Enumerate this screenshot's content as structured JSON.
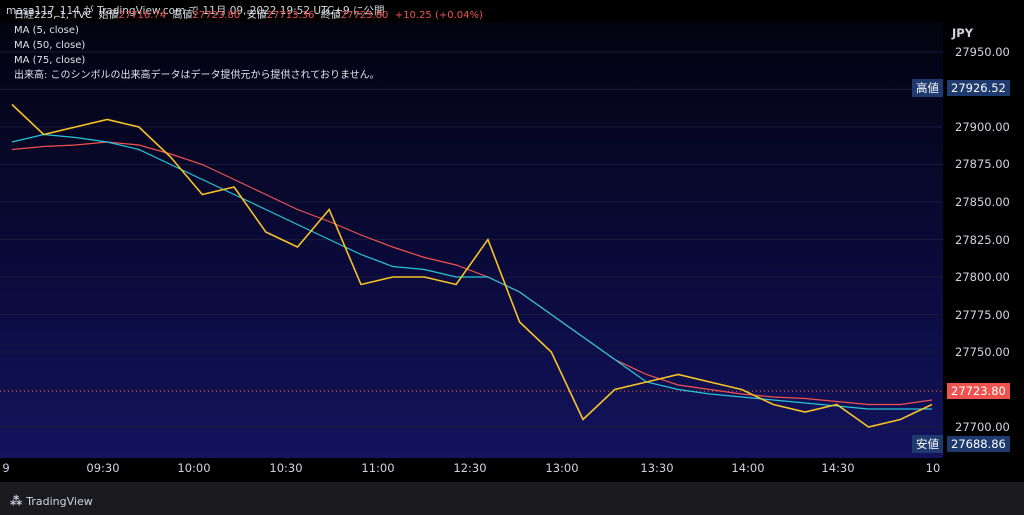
{
  "header": {
    "text": "masa117_114 が TradingView.com で 11月 09, 2022 19:52 UTC+9 に公開"
  },
  "legend": {
    "symbol": "日経225, 1, TVC",
    "open_label": "始値",
    "open": "27716.74",
    "high_label": "高値",
    "high": "27723.80",
    "low_label": "安値",
    "low": "27713.36",
    "close_label": "終値",
    "close": "27723.80",
    "change": "+10.25 (+0.04%)",
    "ma5": "MA (5, close)",
    "ma50": "MA (50, close)",
    "ma75": "MA (75, close)",
    "volume_note": "出来高: このシンボルの出来高データはデータ提供元から提供されておりません。"
  },
  "price_axis": {
    "currency": "JPY",
    "ticks": [
      "27950.00",
      "27925.00",
      "27900.00",
      "27875.00",
      "27850.00",
      "27825.00",
      "27800.00",
      "27775.00",
      "27750.00",
      "27725.00",
      "27700.00"
    ],
    "high_label": "高値",
    "high_value": "27926.52",
    "low_label": "安値",
    "low_value": "27688.86",
    "last_value": "27723.80"
  },
  "time_axis": {
    "labels": [
      "9",
      "09:30",
      "10:00",
      "10:30",
      "11:00",
      "12:30",
      "13:00",
      "13:30",
      "14:00",
      "14:30",
      "10"
    ]
  },
  "footer": {
    "brand": "TradingView"
  },
  "colors": {
    "up": "#26a69a",
    "down": "#1e88e5",
    "ma5": "#f7c325",
    "ma50": "#26c6da",
    "ma75": "#ef5350"
  },
  "chart_data": {
    "type": "line",
    "title": "日経225, 1, TVC",
    "ylim": [
      27688.86,
      27951
    ],
    "x": [
      "09:00",
      "09:10",
      "09:20",
      "09:30",
      "09:40",
      "09:50",
      "10:00",
      "10:10",
      "10:20",
      "10:30",
      "10:40",
      "10:50",
      "11:00",
      "11:10",
      "11:20",
      "12:30",
      "12:40",
      "12:50",
      "13:00",
      "13:10",
      "13:20",
      "13:30",
      "13:40",
      "13:50",
      "14:00",
      "14:10",
      "14:20",
      "14:30",
      "14:40",
      "14:50"
    ],
    "series": [
      {
        "name": "MA (5, close)",
        "values": [
          27915,
          27895,
          27900,
          27905,
          27900,
          27880,
          27855,
          27860,
          27830,
          27820,
          27845,
          27795,
          27800,
          27800,
          27795,
          27825,
          27770,
          27750,
          27705,
          27725,
          27730,
          27735,
          27730,
          27725,
          27715,
          27710,
          27715,
          27700,
          27705,
          27715
        ]
      },
      {
        "name": "MA (50, close)",
        "values": [
          27890,
          27895,
          27893,
          27890,
          27885,
          27875,
          27865,
          27855,
          27845,
          27835,
          27825,
          27815,
          27807,
          27805,
          27800,
          27800,
          27790,
          27775,
          27760,
          27745,
          27730,
          27725,
          27722,
          27720,
          27718,
          27716,
          27714,
          27712,
          27712,
          27712
        ]
      },
      {
        "name": "MA (75, close)",
        "values": [
          27885,
          27887,
          27888,
          27890,
          27888,
          27882,
          27875,
          27865,
          27855,
          27845,
          27837,
          27828,
          27820,
          27813,
          27808,
          27800,
          27790,
          27775,
          27760,
          27745,
          27735,
          27728,
          27725,
          27722,
          27720,
          27719,
          27717,
          27715,
          27715,
          27718
        ]
      }
    ]
  }
}
